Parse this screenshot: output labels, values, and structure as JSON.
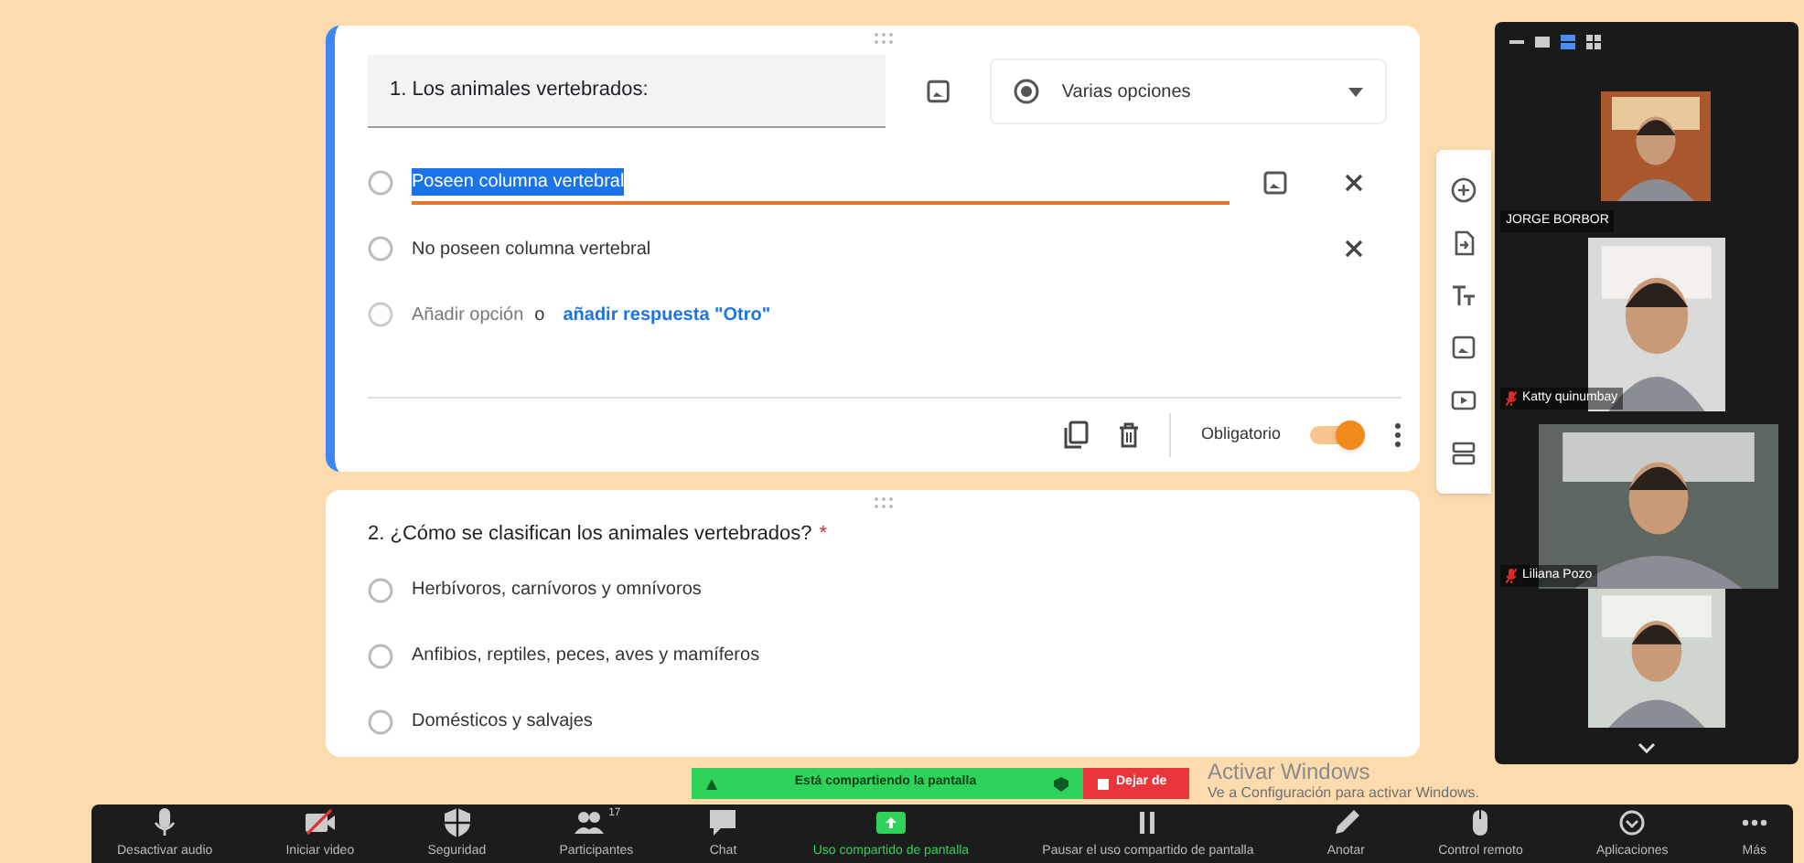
{
  "form": {
    "questions": [
      {
        "kind": "editing",
        "title": "1. Los animales vertebrados:",
        "question_type": "Varias opciones",
        "options": [
          {
            "text": "Poseen columna vertebral",
            "highlighted": true,
            "checked": false
          },
          {
            "text": "No poseen columna vertebral",
            "highlighted": false,
            "checked": false
          }
        ],
        "add_option": "Añadir opción",
        "add_or": "o",
        "add_other": "añadir respuesta \"Otro\"",
        "required_label": "Obligatorio",
        "required_on": true
      },
      {
        "kind": "preview",
        "title": "2. ¿Cómo se clasifican los animales vertebrados?",
        "required_mark": "*",
        "options": [
          {
            "text": "Herbívoros, carnívoros y omnívoros",
            "highlighted": false,
            "checked": false
          },
          {
            "text": "Anfibios, reptiles, peces, aves y mamíferos",
            "highlighted": false,
            "checked": false
          },
          {
            "text": "Domésticos y salvajes",
            "highlighted": false,
            "checked": false
          }
        ]
      }
    ]
  },
  "video_panel": {
    "participants": [
      {
        "kind": "video",
        "name": "JORGE BORBOR",
        "muted": false
      },
      {
        "kind": "video",
        "name": "Katty quinumbay",
        "muted": true
      },
      {
        "kind": "video",
        "name": "Liliana Pozo",
        "muted": true
      },
      {
        "kind": "video"
      }
    ]
  },
  "share_banner": {
    "text": "Está compartiendo la pantalla",
    "stop": "Dejar de"
  },
  "toolbar": [
    {
      "kind": "mic",
      "label": "Desactivar audio"
    },
    {
      "kind": "video",
      "label": "Iniciar video"
    },
    {
      "kind": "shield",
      "label": "Seguridad"
    },
    {
      "kind": "people",
      "label": "Participantes",
      "count": "17"
    },
    {
      "kind": "chat",
      "label": "Chat"
    },
    {
      "kind": "share",
      "label": "Uso compartido de pantalla"
    },
    {
      "kind": "pause",
      "label": "Pausar el uso compartido de pantalla"
    },
    {
      "kind": "pen",
      "label": "Anotar"
    },
    {
      "kind": "mouse",
      "label": "Control remoto"
    },
    {
      "kind": "apps",
      "label": "Aplicaciones"
    },
    {
      "kind": "more",
      "label": "Más"
    }
  ],
  "os_notice": {
    "title": "Activar Windows",
    "text": "Ve a Configuración para activar Windows."
  }
}
